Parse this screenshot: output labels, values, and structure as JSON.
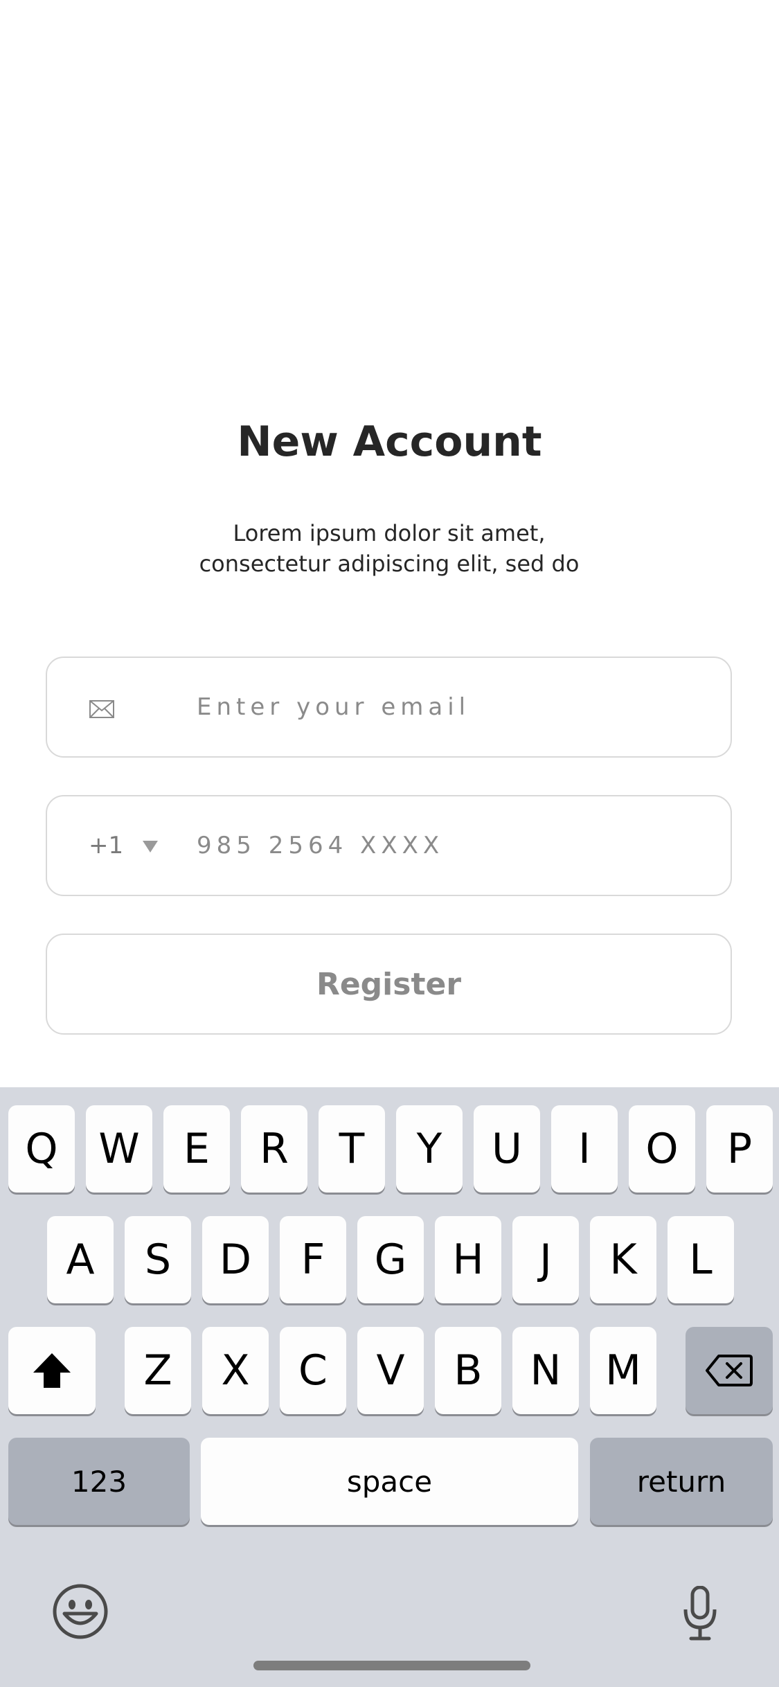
{
  "header": {
    "title": "New Account",
    "subtitle_line1": "Lorem ipsum dolor sit amet,",
    "subtitle_line2": "consectetur adipiscing elit, sed do"
  },
  "form": {
    "email": {
      "icon": "envelope-icon",
      "placeholder": "Enter your email",
      "value": ""
    },
    "phone": {
      "country_code": "+1",
      "country_icon": "caret-down-icon",
      "placeholder": "985 2564 XXXX",
      "value": ""
    },
    "register_label": "Register"
  },
  "keyboard": {
    "row1": [
      "Q",
      "W",
      "E",
      "R",
      "T",
      "Y",
      "U",
      "I",
      "O",
      "P"
    ],
    "row2": [
      "A",
      "S",
      "D",
      "F",
      "G",
      "H",
      "J",
      "K",
      "L"
    ],
    "row3": [
      "Z",
      "X",
      "C",
      "V",
      "B",
      "N",
      "M"
    ],
    "shift_icon": "shift-icon",
    "delete_icon": "backspace-icon",
    "numbers_label": "123",
    "space_label": "space",
    "return_label": "return",
    "emoji_icon": "emoji-icon",
    "mic_icon": "microphone-icon"
  },
  "colors": {
    "text": "#262626",
    "placeholder": "#8a8a8a",
    "field_border": "#d9d9d9",
    "keyboard_bg": "#d5d8df",
    "key_light": "#fdfdfd",
    "key_dark": "#abb0ba"
  }
}
